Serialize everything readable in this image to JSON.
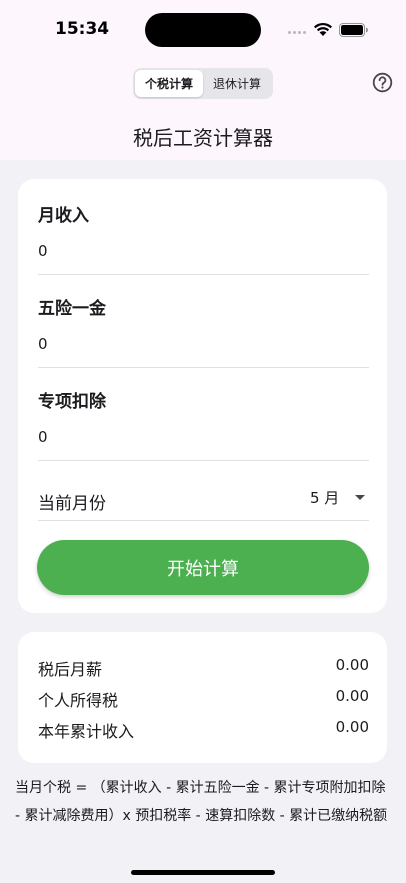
{
  "status_bar": {
    "time": "15:34"
  },
  "header": {
    "tabs": [
      {
        "label": "个税计算",
        "active": true
      },
      {
        "label": "退休计算",
        "active": false
      }
    ],
    "title": "税后工资计算器"
  },
  "form": {
    "monthly_income": {
      "label": "月收入",
      "value": "0"
    },
    "insurance_fund": {
      "label": "五险一金",
      "value": "0"
    },
    "special_deduction": {
      "label": "专项扣除",
      "value": "0"
    },
    "current_month": {
      "label": "当前月份",
      "value": "5 月"
    },
    "calculate_label": "开始计算"
  },
  "results": {
    "rows": [
      {
        "label": "税后月薪",
        "value": "0.00"
      },
      {
        "label": "个人所得税",
        "value": "0.00"
      },
      {
        "label": "本年累计收入",
        "value": "0.00"
      }
    ]
  },
  "formula_text": "当月个税 = （累计收入 - 累计五险一金 - 累计专项附加扣除 - 累计减除费用）x 预扣税率 - 速算扣除数 - 累计已缴纳税额",
  "colors": {
    "accent_green": "#4caf50",
    "header_bg": "#fdf7fd",
    "page_bg": "#f2f1f6"
  }
}
